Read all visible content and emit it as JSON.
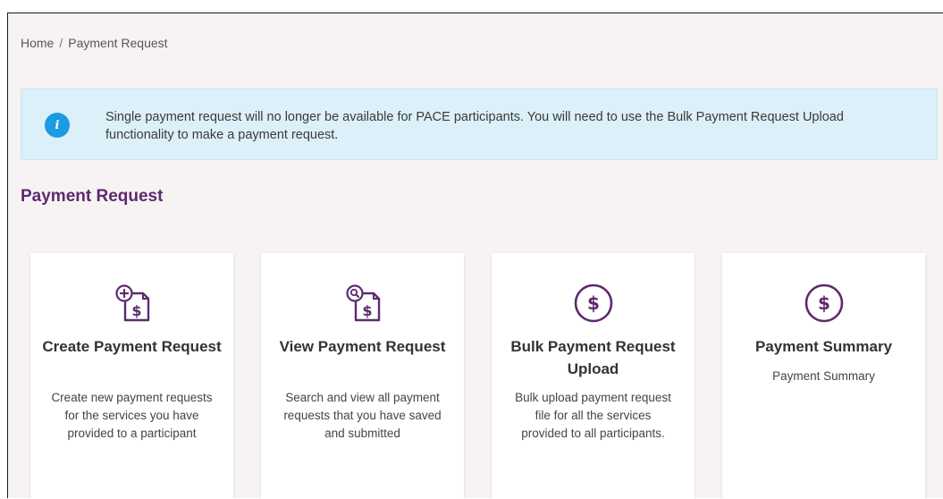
{
  "breadcrumb": {
    "home": "Home",
    "separator": "/",
    "current": "Payment Request"
  },
  "alert": {
    "icon": "info-icon",
    "message": "Single payment request will no longer be available for PACE participants. You will need to use the Bulk Payment Request Upload functionality to make a payment request."
  },
  "page": {
    "title": "Payment Request"
  },
  "cards": [
    {
      "icon": "document-add-dollar-icon",
      "title": "Create Payment Request",
      "description": "Create new payment requests for the services you have provided to a participant"
    },
    {
      "icon": "document-search-dollar-icon",
      "title": "View Payment Request",
      "description": "Search and view all payment requests that you have saved and submitted"
    },
    {
      "icon": "dollar-circle-icon",
      "title": "Bulk Payment Request Upload",
      "description": "Bulk upload payment request file for all the services provided to all participants."
    },
    {
      "icon": "dollar-circle-icon",
      "title": "Payment Summary",
      "description": "Payment Summary"
    }
  ],
  "colors": {
    "accent": "#5d2a6e",
    "info": "#1a9be2",
    "alert_bg": "#dcf0f9",
    "page_bg": "#f8f3f3"
  }
}
